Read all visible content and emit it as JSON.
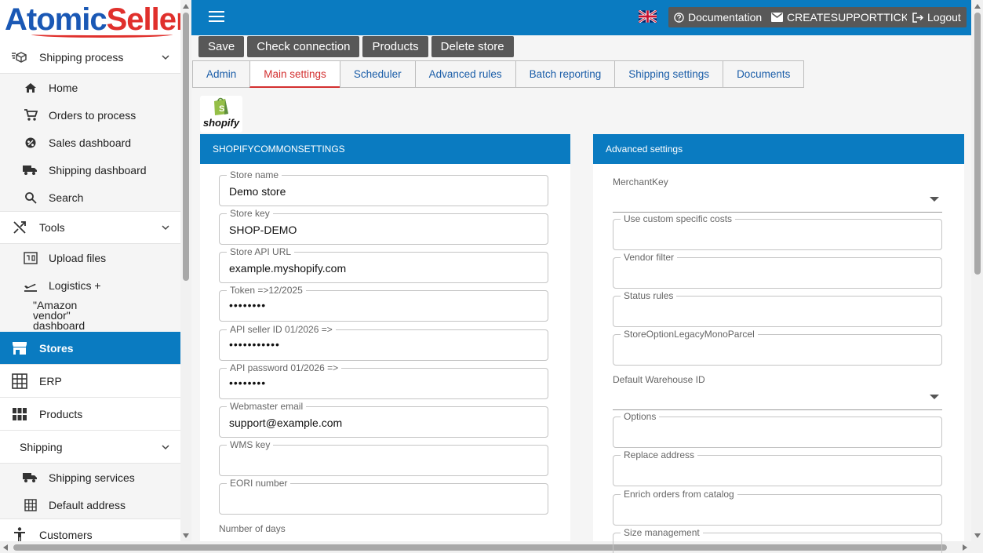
{
  "sidebar": {
    "logo": {
      "part1": "Atomic",
      "part2": "Seller"
    },
    "shipping_process": "Shipping process",
    "shipping_process_items": [
      "Home",
      "Orders to process",
      "Sales dashboard",
      "Shipping dashboard",
      "Search"
    ],
    "tools": "Tools",
    "tools_items": [
      "Upload files",
      "Logistics +"
    ],
    "amazon_vendor": "\"Amazon vendor\" dashboard",
    "stores": "Stores",
    "erp": "ERP",
    "products": "Products",
    "shipping": "Shipping",
    "shipping_items": [
      "Shipping services",
      "Default address"
    ],
    "customers": "Customers"
  },
  "topbar": {
    "documentation": "Documentation",
    "support": "CREATESUPPORTTICKET",
    "logout": "Logout"
  },
  "actions": [
    "Save",
    "Check connection",
    "Products",
    "Delete store"
  ],
  "tabs": [
    "Admin",
    "Main settings",
    "Scheduler",
    "Advanced rules",
    "Batch reporting",
    "Shipping settings",
    "Documents"
  ],
  "active_tab": "Main settings",
  "shopify_logo_text": "shopify",
  "left_panel": {
    "title": "SHOPIFYCOMMONSETTINGS",
    "fields": [
      {
        "label": "Store name",
        "value": "Demo store"
      },
      {
        "label": "Store key",
        "value": "SHOP-DEMO"
      },
      {
        "label": "Store API URL",
        "value": "example.myshopify.com"
      },
      {
        "label": "Token =>12/2025",
        "value": "••••••••"
      },
      {
        "label": "API seller ID 01/2026 =>",
        "value": "•••••••••••"
      },
      {
        "label": "API password 01/2026 =>",
        "value": "••••••••"
      },
      {
        "label": "Webmaster email",
        "value": "support@example.com"
      },
      {
        "label": "WMS key",
        "value": ""
      },
      {
        "label": "EORI number",
        "value": ""
      }
    ],
    "number_of_days_label": "Number of days"
  },
  "right_panel": {
    "title": "Advanced settings",
    "merchant_key_label": "MerchantKey",
    "fields_a": [
      {
        "label": "Use custom specific costs",
        "value": ""
      },
      {
        "label": "Vendor filter",
        "value": ""
      },
      {
        "label": "Status rules",
        "value": ""
      },
      {
        "label": "StoreOptionLegacyMonoParcel",
        "value": ""
      }
    ],
    "default_warehouse_label": "Default Warehouse ID",
    "fields_b": [
      {
        "label": "Options",
        "value": ""
      },
      {
        "label": "Replace address",
        "value": ""
      },
      {
        "label": "Enrich orders from catalog",
        "value": ""
      },
      {
        "label": "Size management",
        "value": ""
      }
    ]
  },
  "colors": {
    "primary": "#0a7bc1",
    "button": "#585858",
    "active_tab": "#d32f2f",
    "logo_blue": "#1a58b5",
    "logo_red": "#e0302c"
  },
  "icons": [
    "package-icon",
    "home-icon",
    "cart-icon",
    "gear-badge-icon",
    "truck-icon",
    "search-icon",
    "shuffle-icon",
    "upload-icon",
    "plane-departure-icon",
    "store-icon",
    "grid-icon",
    "apps-icon",
    "person-icon",
    "flag-uk-icon",
    "help-icon",
    "mail-icon",
    "logout-icon",
    "hamburger-icon"
  ]
}
